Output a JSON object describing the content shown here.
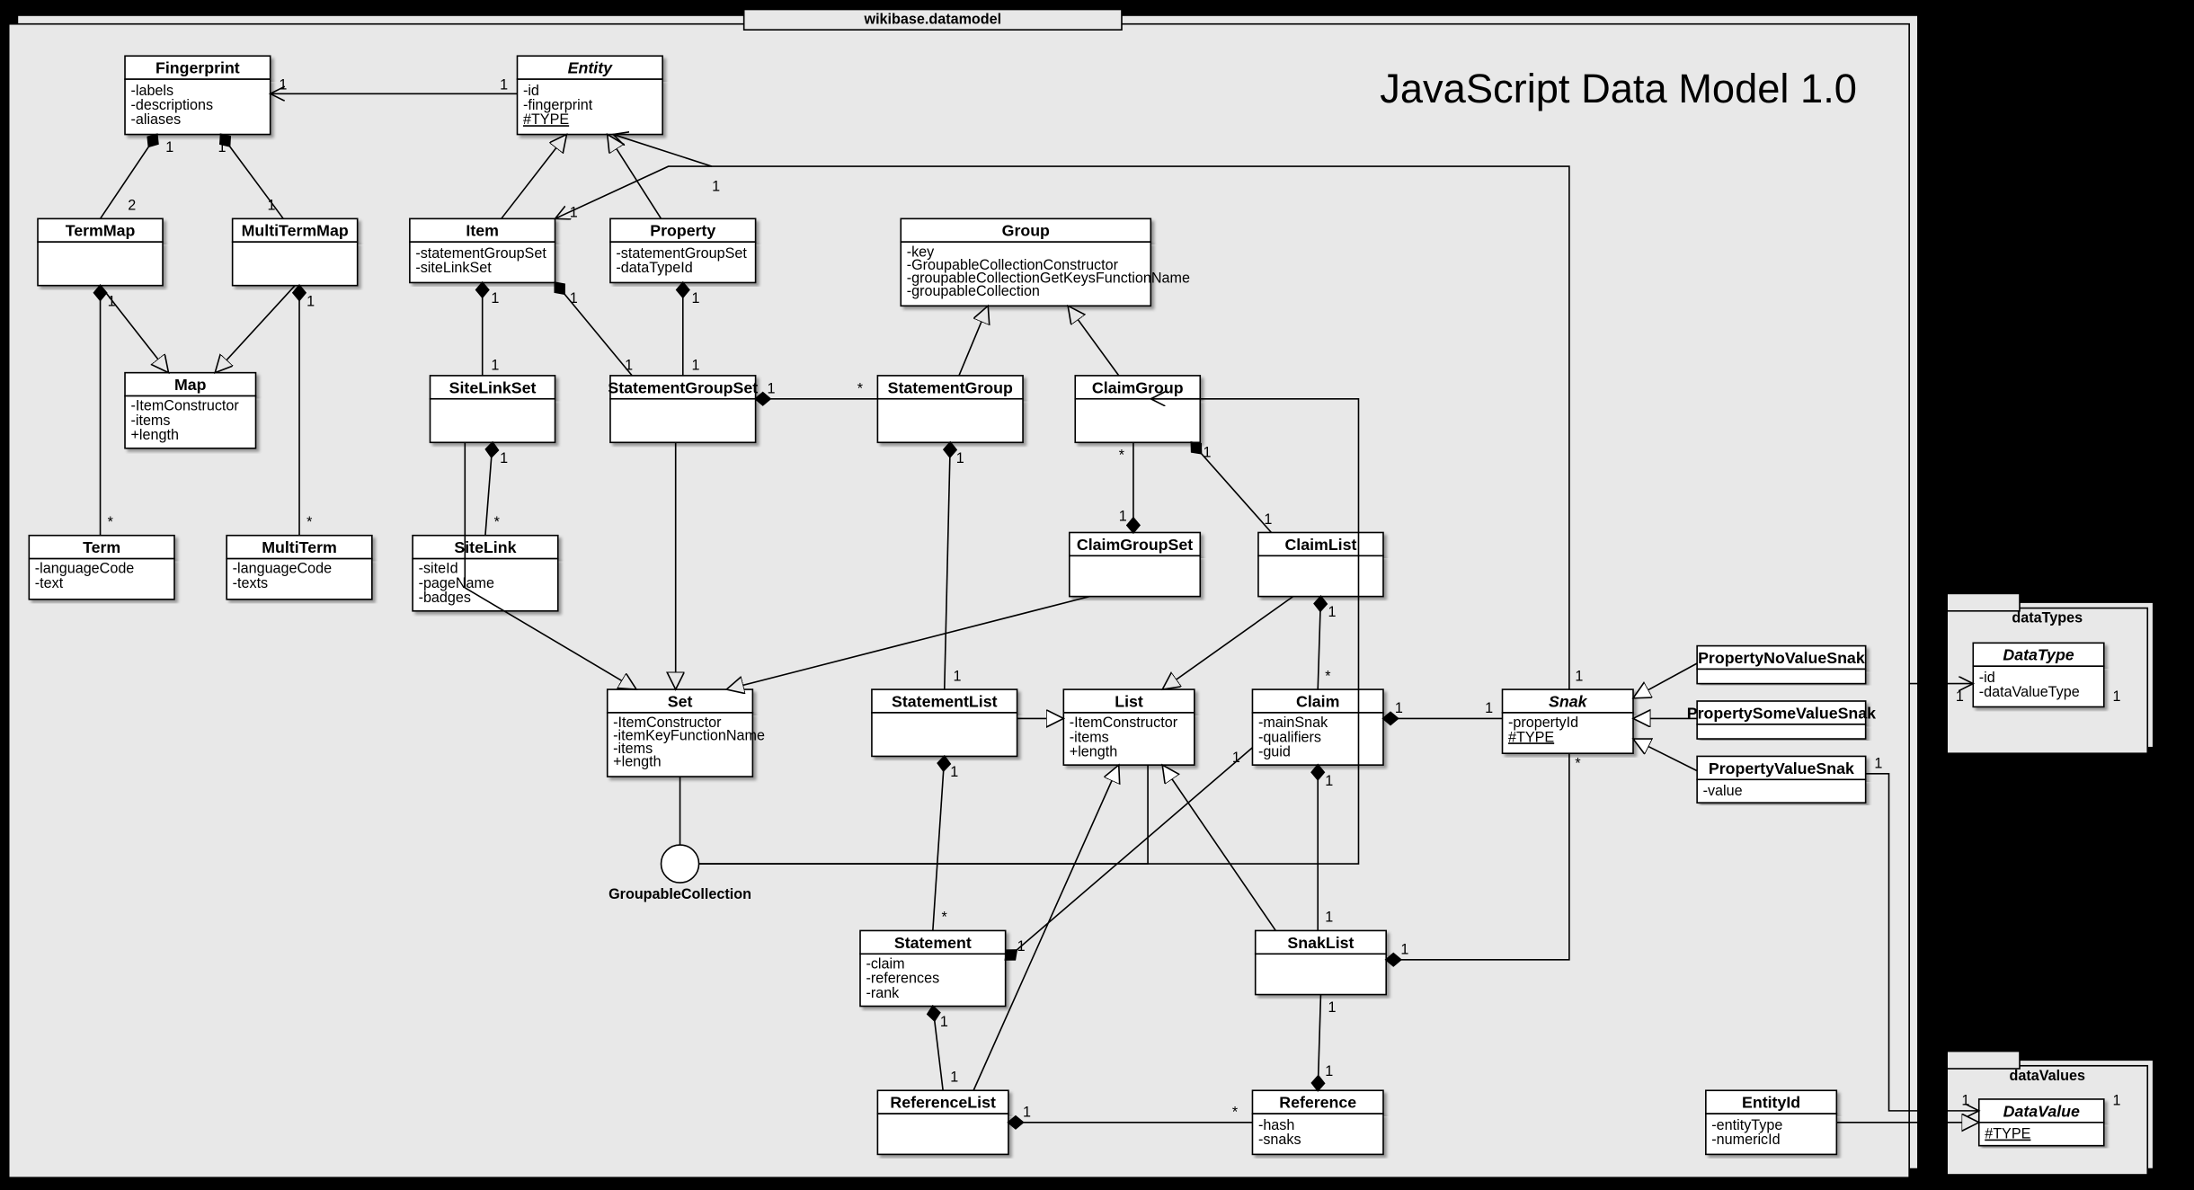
{
  "diagram_title": "JavaScript Data Model 1.0",
  "packages": {
    "main": "wikibase.datamodel",
    "dataTypes": "dataTypes",
    "dataValues": "dataValues"
  },
  "interface": "GroupableCollection",
  "classes": {
    "Fingerprint": {
      "name": "Fingerprint",
      "attrs": [
        "-labels",
        "-descriptions",
        "-aliases"
      ]
    },
    "Entity": {
      "name": "Entity",
      "italic": true,
      "attrs": [
        "-id",
        "-fingerprint",
        "#TYPE"
      ]
    },
    "TermMap": {
      "name": "TermMap",
      "attrs": []
    },
    "MultiTermMap": {
      "name": "MultiTermMap",
      "attrs": []
    },
    "Item": {
      "name": "Item",
      "attrs": [
        "-statementGroupSet",
        "-siteLinkSet"
      ]
    },
    "Property": {
      "name": "Property",
      "attrs": [
        "-statementGroupSet",
        "-dataTypeId"
      ]
    },
    "Group": {
      "name": "Group",
      "attrs": [
        "-key",
        "-GroupableCollectionConstructor",
        "-groupableCollectionGetKeysFunctionName",
        "-groupableCollection"
      ]
    },
    "Map": {
      "name": "Map",
      "attrs": [
        "-ItemConstructor",
        "-items",
        "+length"
      ]
    },
    "SiteLinkSet": {
      "name": "SiteLinkSet",
      "attrs": []
    },
    "StatementGroupSet": {
      "name": "StatementGroupSet",
      "attrs": []
    },
    "StatementGroup": {
      "name": "StatementGroup",
      "attrs": []
    },
    "ClaimGroup": {
      "name": "ClaimGroup",
      "attrs": []
    },
    "Term": {
      "name": "Term",
      "attrs": [
        "-languageCode",
        "-text"
      ]
    },
    "MultiTerm": {
      "name": "MultiTerm",
      "attrs": [
        "-languageCode",
        "-texts"
      ]
    },
    "SiteLink": {
      "name": "SiteLink",
      "attrs": [
        "-siteId",
        "-pageName",
        "-badges"
      ]
    },
    "ClaimGroupSet": {
      "name": "ClaimGroupSet",
      "attrs": []
    },
    "ClaimList": {
      "name": "ClaimList",
      "attrs": []
    },
    "Set": {
      "name": "Set",
      "attrs": [
        "-ItemConstructor",
        "-itemKeyFunctionName",
        "-items",
        "+length"
      ]
    },
    "StatementList": {
      "name": "StatementList",
      "attrs": []
    },
    "List": {
      "name": "List",
      "attrs": [
        "-ItemConstructor",
        "-items",
        "+length"
      ]
    },
    "Claim": {
      "name": "Claim",
      "attrs": [
        "-mainSnak",
        "-qualifiers",
        "-guid"
      ]
    },
    "Snak": {
      "name": "Snak",
      "italic": true,
      "attrs": [
        "-propertyId",
        "#TYPE"
      ]
    },
    "PropertyNoValueSnak": {
      "name": "PropertyNoValueSnak",
      "attrs": []
    },
    "PropertySomeValueSnak": {
      "name": "PropertySomeValueSnak",
      "attrs": []
    },
    "PropertyValueSnak": {
      "name": "PropertyValueSnak",
      "attrs": [
        "-value"
      ]
    },
    "Statement": {
      "name": "Statement",
      "attrs": [
        "-claim",
        "-references",
        "-rank"
      ]
    },
    "SnakList": {
      "name": "SnakList",
      "attrs": []
    },
    "ReferenceList": {
      "name": "ReferenceList",
      "attrs": []
    },
    "Reference": {
      "name": "Reference",
      "attrs": [
        "-hash",
        "-snaks"
      ]
    },
    "EntityId": {
      "name": "EntityId",
      "attrs": [
        "-entityType",
        "-numericId"
      ]
    },
    "DataType": {
      "name": "DataType",
      "italic": true,
      "attrs": [
        "-id",
        "-dataValueType"
      ]
    },
    "DataValue": {
      "name": "DataValue",
      "italic": true,
      "attrs": [
        "#TYPE"
      ]
    }
  },
  "labels": {
    "one": "1",
    "star": "*",
    "two": "2"
  }
}
